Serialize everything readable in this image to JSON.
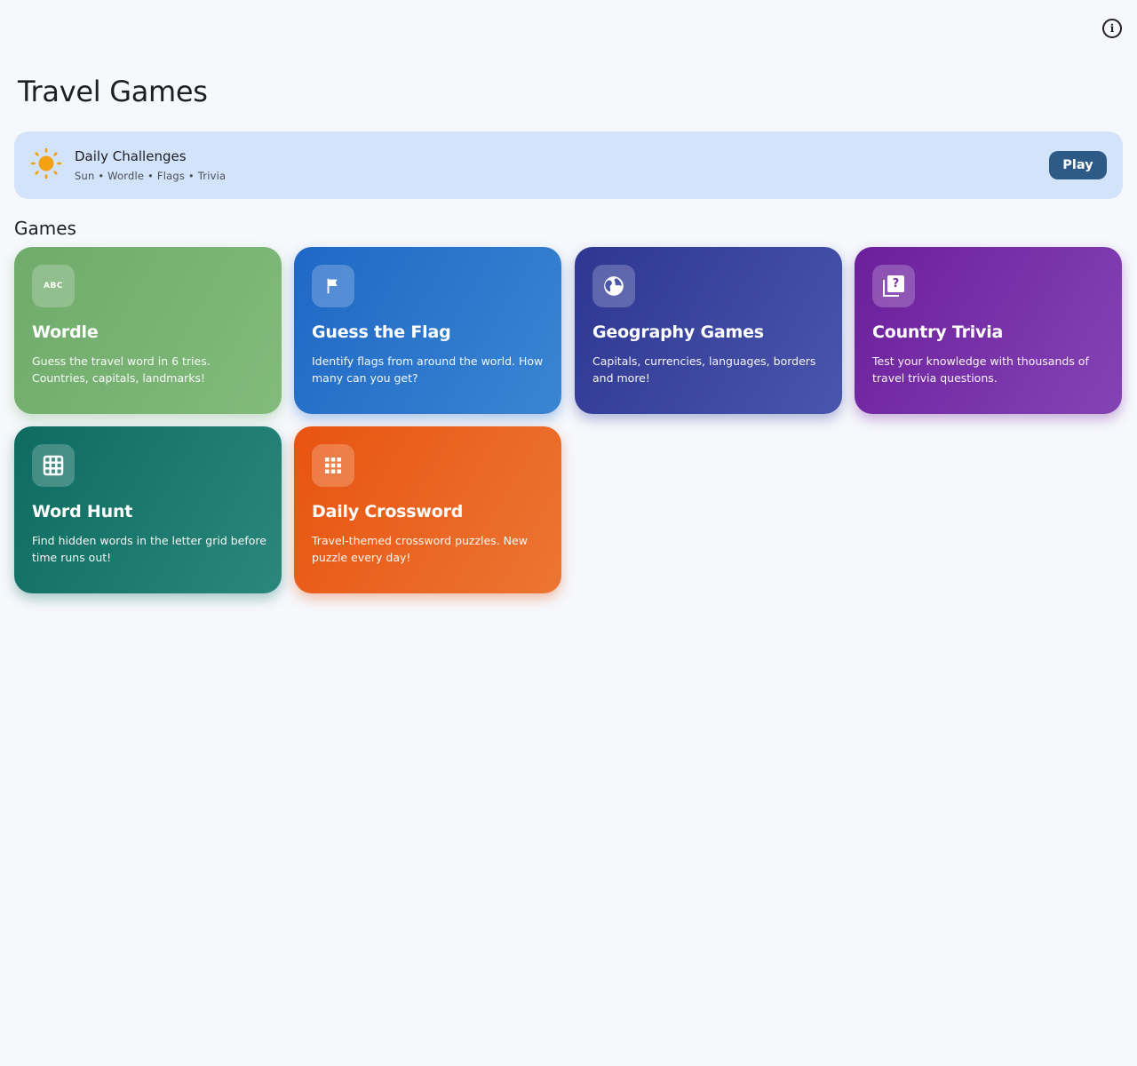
{
  "header": {
    "title": "Travel Games",
    "info_icon": "info-circle-icon"
  },
  "daily": {
    "title": "Daily Challenges",
    "subtitle": "Sun • Wordle • Flags • Trivia",
    "icon": "sun-icon",
    "play_label": "Play",
    "accent_color": "#f5a114"
  },
  "games_section": {
    "title": "Games"
  },
  "games": [
    {
      "title": "Wordle",
      "description": "Guess the travel word in 6 tries. Countries, capitals, landmarks!",
      "icon": "abc-icon",
      "color": "#6fab6b",
      "icon_text": "ABC"
    },
    {
      "title": "Guess the Flag",
      "description": "Identify flags from around the world. How many can you get?",
      "icon": "flag-icon",
      "color": "#1f68c6"
    },
    {
      "title": "Geography Games",
      "description": "Capitals, currencies, languages, borders and more!",
      "icon": "globe-icon",
      "color": "#2d3792"
    },
    {
      "title": "Country Trivia",
      "description": "Test your knowledge with thousands of travel trivia questions.",
      "icon": "quiz-icon",
      "color": "#6c1f9c",
      "icon_text": "?"
    },
    {
      "title": "Word Hunt",
      "description": "Find hidden words in the letter grid before time runs out!",
      "icon": "grid-icon",
      "color": "#0d6b60"
    },
    {
      "title": "Daily Crossword",
      "description": "Travel-themed crossword puzzles. New puzzle every day!",
      "icon": "apps-icon",
      "color": "#e85410"
    }
  ]
}
